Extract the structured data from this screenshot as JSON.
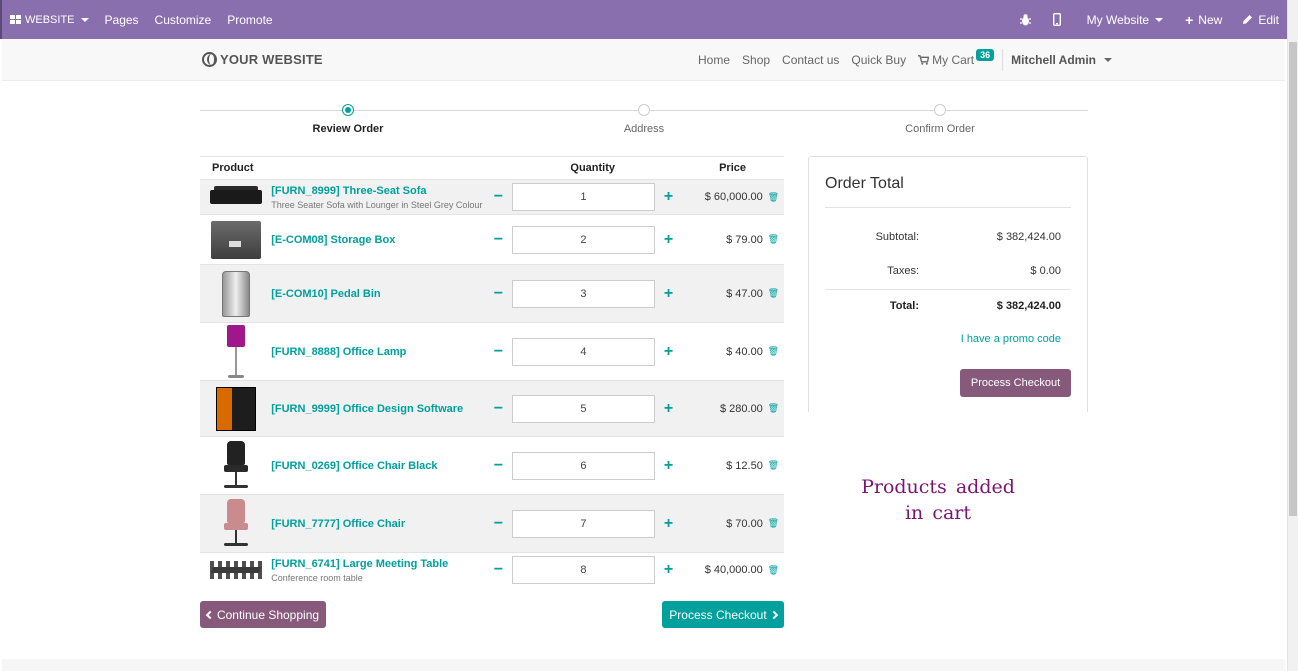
{
  "adminbar": {
    "brand": "WEBSITE",
    "menu": [
      "Pages",
      "Customize",
      "Promote"
    ],
    "site_selector": "My Website",
    "new_label": "New",
    "edit_label": "Edit"
  },
  "header": {
    "logo_text": "YOUR WEBSITE",
    "nav": [
      "Home",
      "Shop",
      "Contact us",
      "Quick Buy"
    ],
    "cart_label": "My Cart",
    "cart_count": "36",
    "user": "Mitchell Admin"
  },
  "steps": [
    {
      "label": "Review Order",
      "active": true
    },
    {
      "label": "Address",
      "active": false
    },
    {
      "label": "Confirm Order",
      "active": false
    }
  ],
  "table": {
    "headers": {
      "product": "Product",
      "quantity": "Quantity",
      "price": "Price"
    },
    "rows": [
      {
        "name": "[FURN_8999] Three-Seat Sofa",
        "desc": "Three Seater Sofa with Lounger in Steel Grey Colour",
        "qty": "1",
        "price": "$ 60,000.00",
        "image": "sofa"
      },
      {
        "name": "[E-COM08] Storage Box",
        "desc": "",
        "qty": "2",
        "price": "$ 79.00",
        "image": "storage-box"
      },
      {
        "name": "[E-COM10] Pedal Bin",
        "desc": "",
        "qty": "3",
        "price": "$ 47.00",
        "image": "pedal-bin"
      },
      {
        "name": "[FURN_8888] Office Lamp",
        "desc": "",
        "qty": "4",
        "price": "$ 40.00",
        "image": "lamp"
      },
      {
        "name": "[FURN_9999] Office Design Software",
        "desc": "",
        "qty": "5",
        "price": "$ 280.00",
        "image": "software"
      },
      {
        "name": "[FURN_0269] Office Chair Black",
        "desc": "",
        "qty": "6",
        "price": "$ 12.50",
        "image": "chair-black"
      },
      {
        "name": "[FURN_7777] Office Chair",
        "desc": "",
        "qty": "7",
        "price": "$ 70.00",
        "image": "chair-pink"
      },
      {
        "name": "[FURN_6741] Large Meeting Table",
        "desc": "Conference room table",
        "qty": "8",
        "price": "$ 40,000.00",
        "image": "meeting-table"
      }
    ]
  },
  "buttons": {
    "continue": "Continue Shopping",
    "checkout": "Process Checkout"
  },
  "order_total": {
    "title": "Order Total",
    "subtotal_label": "Subtotal:",
    "subtotal": "$ 382,424.00",
    "taxes_label": "Taxes:",
    "taxes": "$ 0.00",
    "total_label": "Total:",
    "total": "$ 382,424.00",
    "promo": "I have a promo code",
    "checkout": "Process Checkout"
  },
  "annotation": "Products added in cart",
  "colors": {
    "admin_bar": "#8a6fae",
    "teal": "#00a09d",
    "purple_btn": "#875a7b",
    "annotation": "#7a1574"
  }
}
